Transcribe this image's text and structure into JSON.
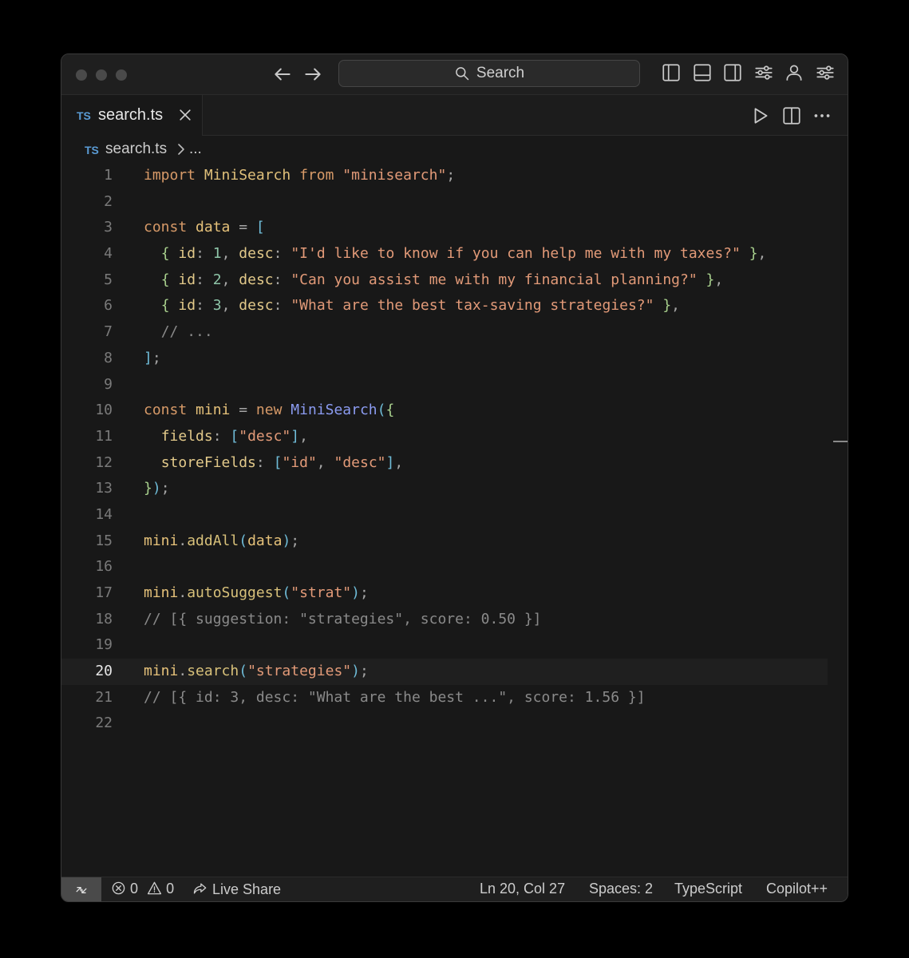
{
  "titlebar": {
    "search_label": "Search"
  },
  "tab": {
    "lang_badge": "TS",
    "filename": "search.ts"
  },
  "breadcrumb": {
    "lang_badge": "TS",
    "filename": "search.ts",
    "ellipsis": "..."
  },
  "code": {
    "active_line": 20,
    "lines": [
      {
        "n": "1",
        "tokens": [
          [
            "kw",
            "import "
          ],
          [
            "cls",
            "MiniSearch"
          ],
          [
            "kw",
            " from "
          ],
          [
            "str",
            "\"minisearch\""
          ],
          [
            "pn",
            ";"
          ]
        ]
      },
      {
        "n": "2",
        "tokens": []
      },
      {
        "n": "3",
        "tokens": [
          [
            "kw",
            "const "
          ],
          [
            "var",
            "data"
          ],
          [
            "pn",
            " = "
          ],
          [
            "br",
            "["
          ]
        ]
      },
      {
        "n": "4",
        "tokens": [
          [
            "",
            "  "
          ],
          [
            "br2",
            "{ "
          ],
          [
            "prop",
            "id"
          ],
          [
            "pn",
            ": "
          ],
          [
            "num",
            "1"
          ],
          [
            "pn",
            ", "
          ],
          [
            "prop",
            "desc"
          ],
          [
            "pn",
            ": "
          ],
          [
            "str",
            "\"I'd like to know if you can help me with my taxes?\""
          ],
          [
            "br2",
            " }"
          ],
          [
            "pn",
            ","
          ]
        ]
      },
      {
        "n": "5",
        "tokens": [
          [
            "",
            "  "
          ],
          [
            "br2",
            "{ "
          ],
          [
            "prop",
            "id"
          ],
          [
            "pn",
            ": "
          ],
          [
            "num",
            "2"
          ],
          [
            "pn",
            ", "
          ],
          [
            "prop",
            "desc"
          ],
          [
            "pn",
            ": "
          ],
          [
            "str",
            "\"Can you assist me with my financial planning?\""
          ],
          [
            "br2",
            " }"
          ],
          [
            "pn",
            ","
          ]
        ]
      },
      {
        "n": "6",
        "tokens": [
          [
            "",
            "  "
          ],
          [
            "br2",
            "{ "
          ],
          [
            "prop",
            "id"
          ],
          [
            "pn",
            ": "
          ],
          [
            "num",
            "3"
          ],
          [
            "pn",
            ", "
          ],
          [
            "prop",
            "desc"
          ],
          [
            "pn",
            ": "
          ],
          [
            "str",
            "\"What are the best tax-saving strategies?\""
          ],
          [
            "br2",
            " }"
          ],
          [
            "pn",
            ","
          ]
        ]
      },
      {
        "n": "7",
        "tokens": [
          [
            "",
            "  "
          ],
          [
            "cm",
            "// ..."
          ]
        ]
      },
      {
        "n": "8",
        "tokens": [
          [
            "br",
            "]"
          ],
          [
            "pn",
            ";"
          ]
        ]
      },
      {
        "n": "9",
        "tokens": []
      },
      {
        "n": "10",
        "tokens": [
          [
            "kw",
            "const "
          ],
          [
            "var",
            "mini"
          ],
          [
            "pn",
            " = "
          ],
          [
            "kw",
            "new "
          ],
          [
            "fn",
            "MiniSearch"
          ],
          [
            "br",
            "("
          ],
          [
            "br2",
            "{"
          ]
        ]
      },
      {
        "n": "11",
        "tokens": [
          [
            "",
            "  "
          ],
          [
            "prop",
            "fields"
          ],
          [
            "pn",
            ": "
          ],
          [
            "br",
            "["
          ],
          [
            "str",
            "\"desc\""
          ],
          [
            "br",
            "]"
          ],
          [
            "pn",
            ","
          ]
        ]
      },
      {
        "n": "12",
        "tokens": [
          [
            "",
            "  "
          ],
          [
            "prop",
            "storeFields"
          ],
          [
            "pn",
            ": "
          ],
          [
            "br",
            "["
          ],
          [
            "str",
            "\"id\""
          ],
          [
            "pn",
            ", "
          ],
          [
            "str",
            "\"desc\""
          ],
          [
            "br",
            "]"
          ],
          [
            "pn",
            ","
          ]
        ]
      },
      {
        "n": "13",
        "tokens": [
          [
            "br2",
            "}"
          ],
          [
            "br",
            ")"
          ],
          [
            "pn",
            ";"
          ]
        ]
      },
      {
        "n": "14",
        "tokens": []
      },
      {
        "n": "15",
        "tokens": [
          [
            "var",
            "mini"
          ],
          [
            "pn",
            "."
          ],
          [
            "meth",
            "addAll"
          ],
          [
            "br",
            "("
          ],
          [
            "var",
            "data"
          ],
          [
            "br",
            ")"
          ],
          [
            "pn",
            ";"
          ]
        ]
      },
      {
        "n": "16",
        "tokens": []
      },
      {
        "n": "17",
        "tokens": [
          [
            "var",
            "mini"
          ],
          [
            "pn",
            "."
          ],
          [
            "meth",
            "autoSuggest"
          ],
          [
            "br",
            "("
          ],
          [
            "str",
            "\"strat\""
          ],
          [
            "br",
            ")"
          ],
          [
            "pn",
            ";"
          ]
        ]
      },
      {
        "n": "18",
        "tokens": [
          [
            "cm",
            "// [{ suggestion: \"strategies\", score: 0.50 }]"
          ]
        ]
      },
      {
        "n": "19",
        "tokens": []
      },
      {
        "n": "20",
        "tokens": [
          [
            "var",
            "mini"
          ],
          [
            "pn",
            "."
          ],
          [
            "meth",
            "search"
          ],
          [
            "br",
            "("
          ],
          [
            "str",
            "\"strategies\""
          ],
          [
            "br",
            ")"
          ],
          [
            "pn",
            ";"
          ]
        ]
      },
      {
        "n": "21",
        "tokens": [
          [
            "cm",
            "// [{ id: 3, desc: \"What are the best ...\", score: 1.56 }]"
          ]
        ]
      },
      {
        "n": "22",
        "tokens": []
      }
    ]
  },
  "statusbar": {
    "errors": "0",
    "warnings": "0",
    "live_share": "Live Share",
    "cursor": "Ln 20, Col 27",
    "spaces": "Spaces: 2",
    "language": "TypeScript",
    "copilot": "Copilot++"
  }
}
